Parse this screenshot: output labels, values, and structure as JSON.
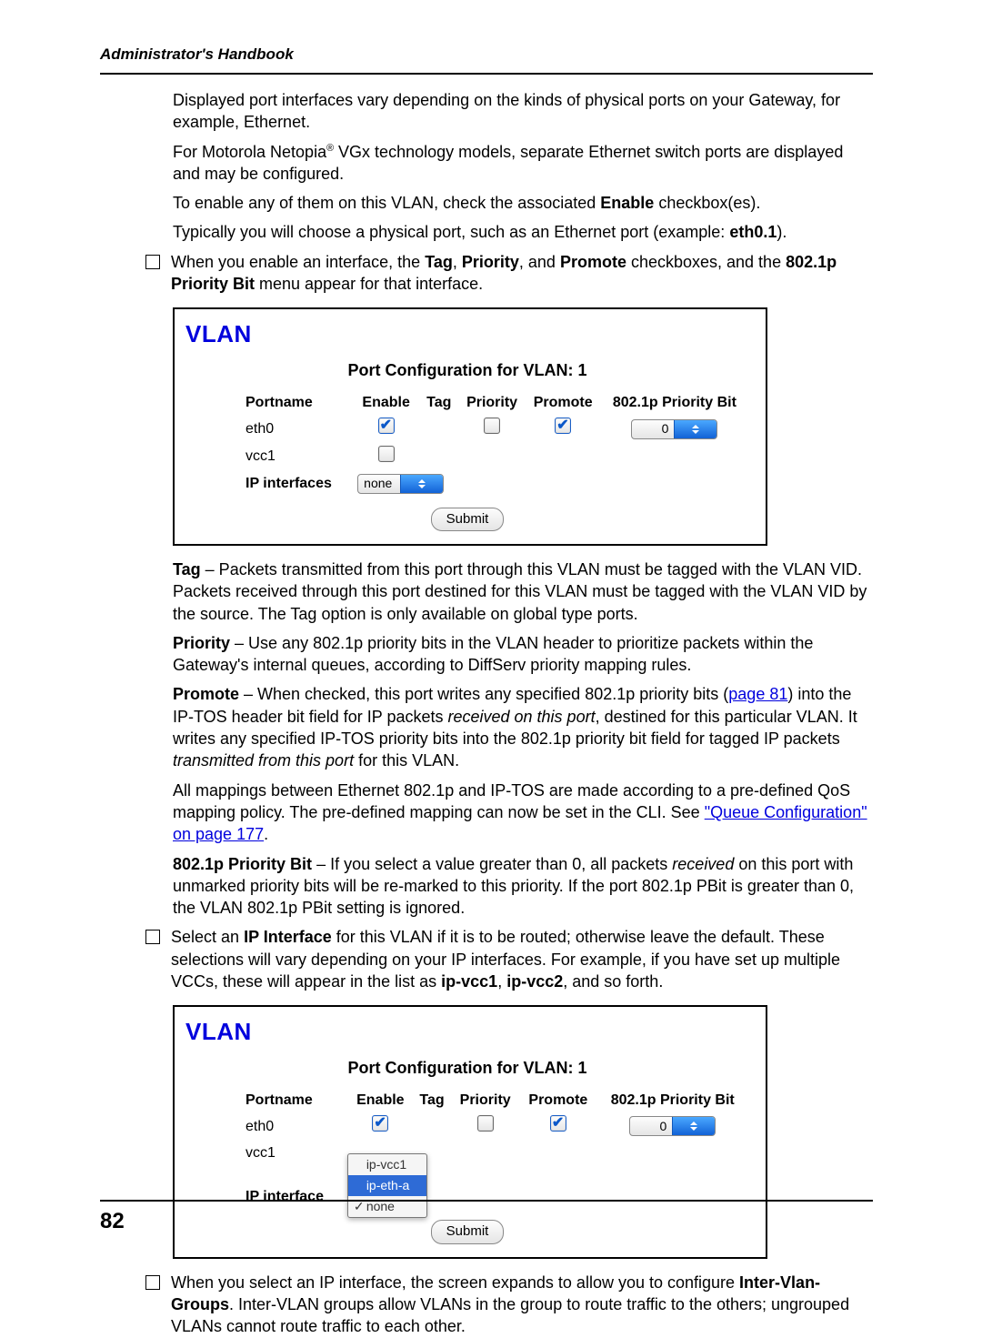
{
  "header": {
    "running": "Administrator's Handbook"
  },
  "page_number": "82",
  "intro": {
    "p1_a": "Displayed port interfaces vary depending on the kinds of physical ports on your Gateway, for example, Ethernet.",
    "p2_a": "For Motorola Netopia",
    "p2_sup": "®",
    "p2_b": " VGx technology models, separate Ethernet switch ports are displayed and may be configured.",
    "p3_a": "To enable any of them on this VLAN, check the associated ",
    "p3_b": "Enable",
    "p3_c": " checkbox(es).",
    "p4_a": "Typically you will choose a physical port, such as an Ethernet port (example: ",
    "p4_b": "eth0.1",
    "p4_c": ")."
  },
  "bullet1": {
    "a": "When you enable an interface, the ",
    "b1": "Tag",
    "sep1": ", ",
    "b2": "Priority",
    "sep2": ", and ",
    "b3": "Promote",
    "mid": " checkboxes, and the ",
    "b4": "802.1p Priority Bit",
    "end": " menu appear for that interface."
  },
  "panel": {
    "title": "VLAN",
    "subtitle": "Port Configuration for VLAN: 1",
    "th": {
      "portname": "Portname",
      "enable": "Enable",
      "tag": "Tag",
      "priority": "Priority",
      "promote": "Promote",
      "pbit": "802.1p Priority Bit"
    },
    "rows": {
      "r1": {
        "pn": "eth0",
        "pbit": "0"
      },
      "r2": {
        "pn": "vcc1"
      }
    },
    "ip_label": "IP interfaces",
    "ip_label2": "IP interface",
    "ip_sel": "none",
    "submit": "Submit"
  },
  "defs": {
    "tag_b": "Tag",
    "tag_txt": " – Packets transmitted from this port through this VLAN must be tagged with the VLAN VID. Packets received through this port destined for this VLAN must be tagged with the VLAN VID by the source. The Tag option is only available on global type ports.",
    "pri_b": "Priority",
    "pri_txt": " – Use any 802.1p priority bits in the VLAN header to prioritize packets within the Gateway's internal queues, according to DiffServ priority mapping rules.",
    "pro_b": "Promote",
    "pro_1": " – When checked, this port writes any specified 802.1p priority bits (",
    "pro_link": "page 81",
    "pro_2": ") into the IP-TOS header bit field for IP packets ",
    "pro_i1": "received on this port",
    "pro_3": ", destined for this particular VLAN. It writes any specified IP-TOS priority bits into the 802.1p priority bit field for tagged IP packets ",
    "pro_i2": "transmitted from this port",
    "pro_4": " for this VLAN.",
    "map_1": "All mappings between Ethernet 802.1p and IP-TOS are made according to a pre-defined QoS mapping policy. The pre-defined mapping can now be set in the CLI. See ",
    "map_link": "\"Queue Configuration\" on page 177",
    "map_2": ".",
    "pbit_b": "802.1p Priority Bit",
    "pbit_1": " – If you select a value greater than 0, all packets ",
    "pbit_i": "received",
    "pbit_2": " on this port with unmarked priority bits will be re-marked to this priority. If the port 802.1p PBit is greater than 0, the VLAN 802.1p PBit setting is ignored."
  },
  "bullet2": {
    "a": "Select an ",
    "b": "IP Interface",
    "c": " for this VLAN if it is to be routed; otherwise leave the default. These selections will vary depending on your IP interfaces. For example, if you have set up multiple VCCs, these will appear in the list as ",
    "d": "ip-vcc1",
    "sep": ", ",
    "e": "ip-vcc2",
    "f": ", and so forth."
  },
  "menu": {
    "opt1": "ip-vcc1",
    "opt2": "ip-eth-a",
    "opt3": "none"
  },
  "bullet3": {
    "a": "When you select an IP interface, the screen expands to allow you to configure ",
    "b": "Inter-Vlan-Groups",
    "c": ". Inter-VLAN groups allow VLANs in the group to route traffic to the others; ungrouped VLANs cannot route traffic to each other."
  }
}
